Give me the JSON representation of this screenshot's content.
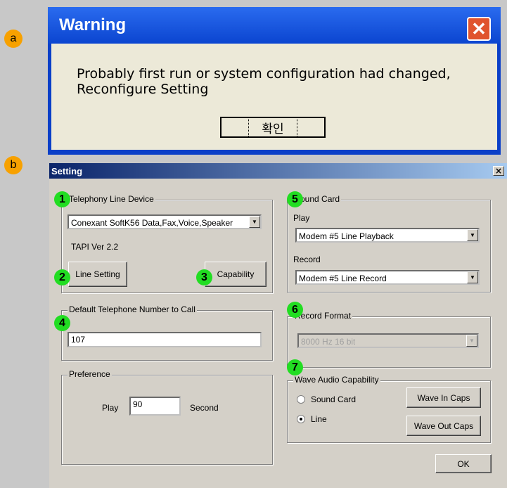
{
  "markers": {
    "a": "a",
    "b": "b"
  },
  "warning": {
    "title": "Warning",
    "close": "✕",
    "message_line1": "Probably first run or system configuration had changed,",
    "message_line2": "Reconfigure Setting",
    "ok_label": "확인"
  },
  "setting": {
    "title": "Setting",
    "close": "×",
    "callouts": [
      "1",
      "2",
      "3",
      "4",
      "5",
      "6",
      "7"
    ],
    "telephony": {
      "group_label": "Telephony Line Device",
      "device_value": "Conexant SoftK56 Data,Fax,Voice,Speaker",
      "tapi_version": "TAPI Ver 2.2",
      "line_setting_label": "Line Setting",
      "capability_label": "Capability"
    },
    "default_number": {
      "group_label": "Default Telephone Number to Call",
      "value": "107"
    },
    "preference": {
      "group_label": "Preference",
      "play_label": "Play",
      "play_value": "90",
      "second_label": "Second"
    },
    "sound_card": {
      "group_label": "Sound Card",
      "play_label": "Play",
      "play_value": "Modem #5 Line Playback",
      "record_label": "Record",
      "record_value": "Modem #5 Line Record"
    },
    "record_format": {
      "group_label": "Record Format",
      "value": "8000 Hz 16 bit"
    },
    "wave_audio": {
      "group_label": "Wave Audio Capability",
      "sound_card_option": "Sound Card",
      "line_option": "Line",
      "selected": "Line",
      "wave_in_label": "Wave In Caps",
      "wave_out_label": "Wave Out Caps"
    },
    "ok_label": "OK"
  },
  "colors": {
    "callout_green": "#22dd22",
    "marker_orange": "#f7a100",
    "xp_blue": "#0a3fc8",
    "classic_title": "#0a246a"
  }
}
